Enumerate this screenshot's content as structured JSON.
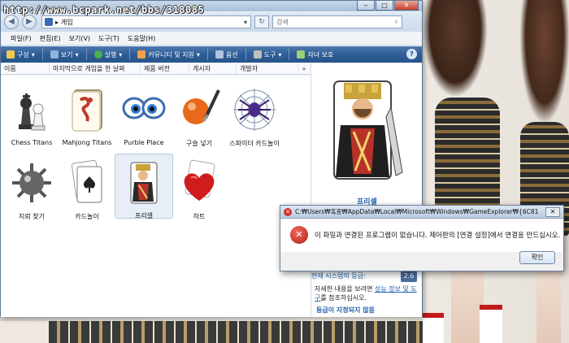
{
  "watermark": "http://www.bcpark.net/bbs/318085",
  "window": {
    "address": "게임",
    "search_placeholder": "검색",
    "controls": {
      "minimize": "‒",
      "maximize": "□",
      "close": "✕"
    }
  },
  "menu": [
    "파일(F)",
    "편집(E)",
    "보기(V)",
    "도구(T)",
    "도움말(H)"
  ],
  "toolbar": [
    {
      "label": "구성",
      "icon": "organize-icon",
      "color": "#f2c94c"
    },
    {
      "label": "보기",
      "icon": "views-icon",
      "color": "#8fb3dc"
    },
    {
      "label": "실행",
      "icon": "play-icon",
      "color": "#4caf50"
    },
    {
      "label": "커뮤니티 및 지원",
      "icon": "community-icon",
      "color": "#f0a04b"
    },
    {
      "label": "옵션",
      "icon": "options-icon",
      "color": "#b0c4de"
    },
    {
      "label": "도구",
      "icon": "tools-icon",
      "color": "#c0c0c0"
    },
    {
      "label": "자녀 보호",
      "icon": "parental-icon",
      "color": "#9bd07a"
    }
  ],
  "columns": [
    "이름",
    "마지막으로 게임을 한 날짜",
    "제품 버전",
    "게시자",
    "개발자",
    "»"
  ],
  "games": [
    {
      "label": "Chess Titans",
      "icon": "chess-icon"
    },
    {
      "label": "Mahjong Titans",
      "icon": "mahjong-icon"
    },
    {
      "label": "Purble Place",
      "icon": "purble-icon"
    },
    {
      "label": "구슬 넣기",
      "icon": "ink-ball-icon"
    },
    {
      "label": "스파이더 카드놀이",
      "icon": "spider-icon"
    },
    {
      "label": "지뢰 찾기",
      "icon": "mine-icon"
    },
    {
      "label": "카드놀이",
      "icon": "solitaire-icon"
    },
    {
      "label": "프리셀",
      "icon": "freecell-icon"
    },
    {
      "label": "하트",
      "icon": "hearts-icon"
    }
  ],
  "preview": {
    "title": "프리셀",
    "rating_label": "현재 시스템의 등급:",
    "rating_value": "2.6",
    "desc_prefix": "자세한 내용을 보려면 ",
    "desc_link": "성능 정보 및 도구",
    "desc_suffix": "를 참조하십시오.",
    "unrated": "등급이 지정되지 않음"
  },
  "dialog": {
    "title": "C:₩Users₩혹흥₩AppData₩Local₩Microsoft₩Windows₩GameExplorer₩{6C815596-...",
    "message": "이 파일과 연결된 프로그램이 없습니다. 제어판의 [연결 설정]에서 연결을 만드십시오.",
    "ok": "확인",
    "close": "✕",
    "error_glyph": "✕"
  }
}
